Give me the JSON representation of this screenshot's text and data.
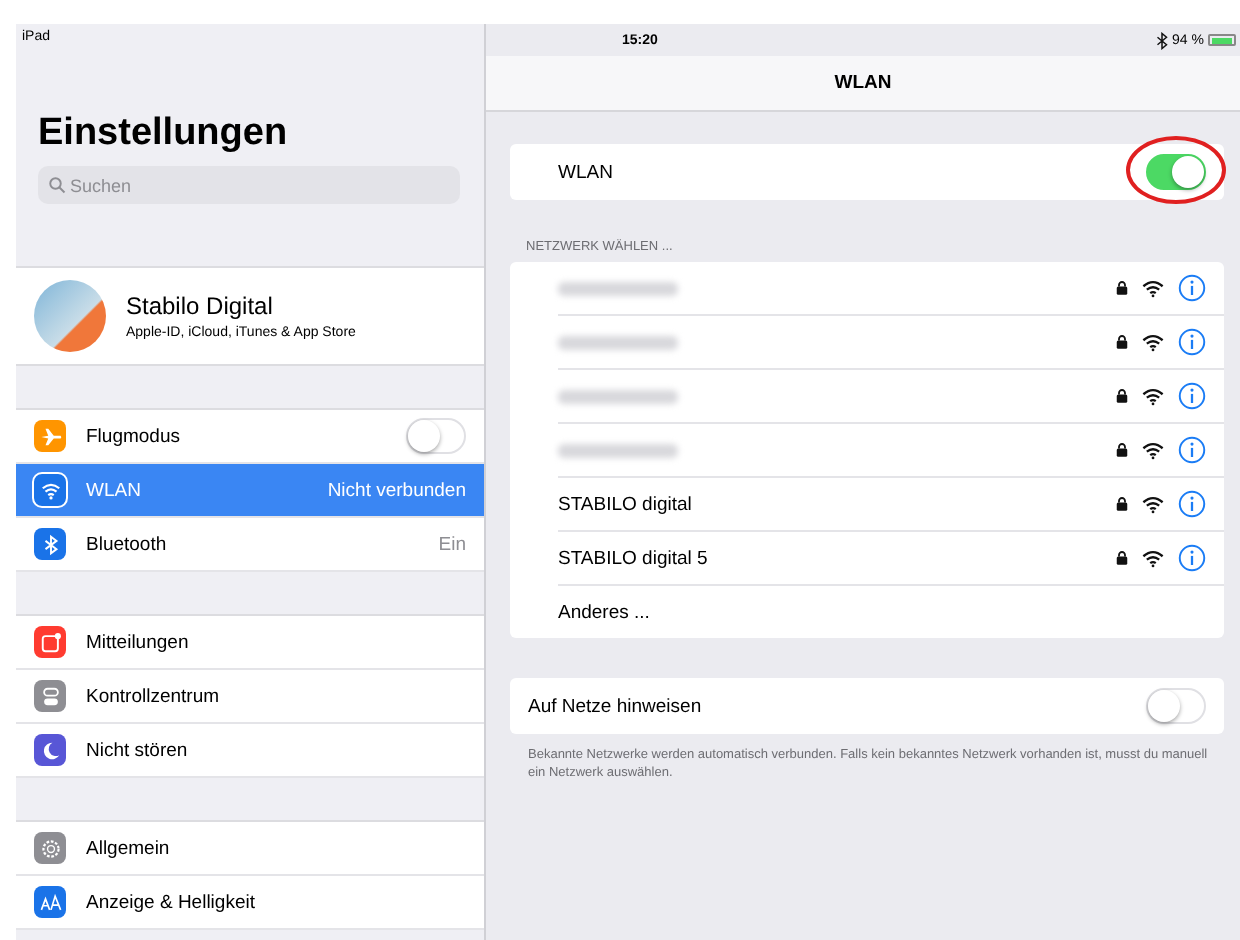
{
  "status_bar": {
    "device": "iPad",
    "time": "15:20",
    "battery": "94 %"
  },
  "sidebar": {
    "title": "Einstellungen",
    "search": {
      "placeholder": "Suchen"
    },
    "profile": {
      "name": "Stabilo Digital",
      "subtitle": "Apple-ID, iCloud, iTunes & App Store"
    },
    "groups": [
      [
        {
          "kind": "toggle",
          "color": "#ff9500",
          "label": "Flugmodus",
          "on": false,
          "selected": false
        },
        {
          "kind": "value",
          "color": "#1a73e8",
          "label": "WLAN",
          "value": "Nicht verbunden",
          "selected": true
        },
        {
          "kind": "value",
          "color": "#1a73e8",
          "label": "Bluetooth",
          "value": "Ein",
          "selected": false
        }
      ],
      [
        {
          "kind": "link",
          "color": "#ff3b30",
          "label": "Mitteilungen",
          "selected": false
        },
        {
          "kind": "link",
          "color": "#8e8e93",
          "label": "Kontrollzentrum",
          "selected": false
        },
        {
          "kind": "link",
          "color": "#5856d6",
          "label": "Nicht stören",
          "selected": false
        }
      ],
      [
        {
          "kind": "link",
          "color": "#8e8e93",
          "label": "Allgemein",
          "selected": false
        },
        {
          "kind": "link",
          "color": "#1a73e8",
          "label": "Anzeige & Helligkeit",
          "selected": false
        }
      ]
    ]
  },
  "detail": {
    "title": "WLAN",
    "wlan": {
      "label": "WLAN",
      "on": true,
      "highlighted": true
    },
    "section_header": "NETZWERK WÄHLEN ...",
    "networks": [
      {
        "kind": "blurred",
        "locked": true
      },
      {
        "kind": "blurred",
        "locked": true
      },
      {
        "kind": "blurred",
        "locked": true
      },
      {
        "kind": "blurred",
        "locked": true
      },
      {
        "kind": "named",
        "name": "STABILO digital",
        "locked": true
      },
      {
        "kind": "named",
        "name": "STABILO digital 5",
        "locked": true
      },
      {
        "kind": "other",
        "name": "Anderes ..."
      }
    ],
    "ask": {
      "label": "Auf Netze hinweisen",
      "on": false
    },
    "footnote": "Bekannte Netzwerke werden automatisch verbunden. Falls kein bekanntes Netzwerk vorhanden ist, musst du manuell ein Netzwerk auswählen."
  }
}
